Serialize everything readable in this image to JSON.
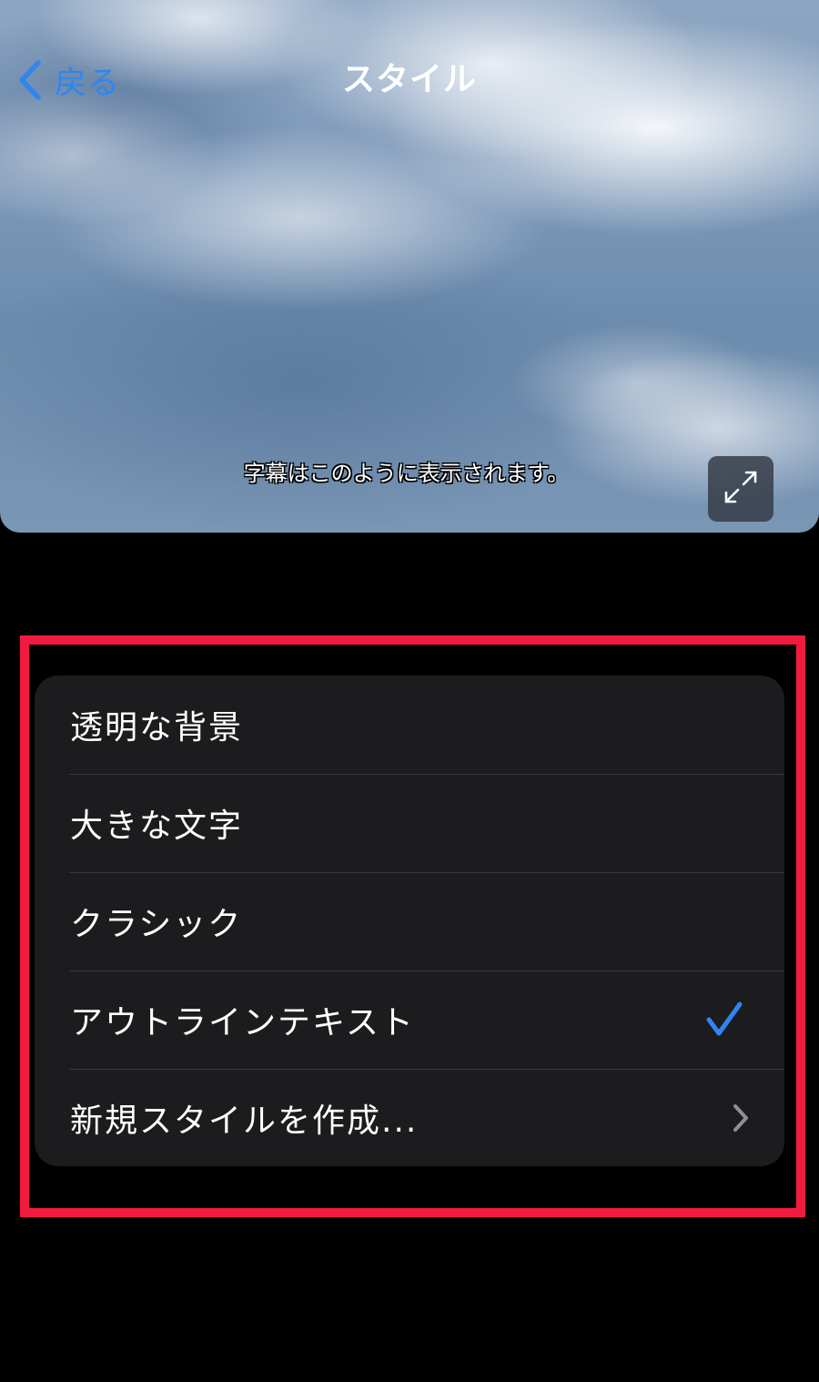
{
  "nav": {
    "back_label": "戻る",
    "title": "スタイル"
  },
  "preview": {
    "caption_sample": "字幕はこのように表示されます。",
    "expand_icon": "expand-arrows-icon"
  },
  "options": {
    "items": [
      {
        "label": "透明な背景",
        "selected": false,
        "accessory": "none"
      },
      {
        "label": "大きな文字",
        "selected": false,
        "accessory": "none"
      },
      {
        "label": "クラシック",
        "selected": false,
        "accessory": "none"
      },
      {
        "label": "アウトラインテキスト",
        "selected": true,
        "accessory": "checkmark-icon"
      },
      {
        "label": "新規スタイルを作成...",
        "selected": false,
        "accessory": "chevron-right-icon"
      }
    ]
  },
  "colors": {
    "accent": "#2f86f0",
    "highlight_border": "#f21b3f",
    "list_background": "#1c1c1e",
    "page_background": "#000000"
  }
}
